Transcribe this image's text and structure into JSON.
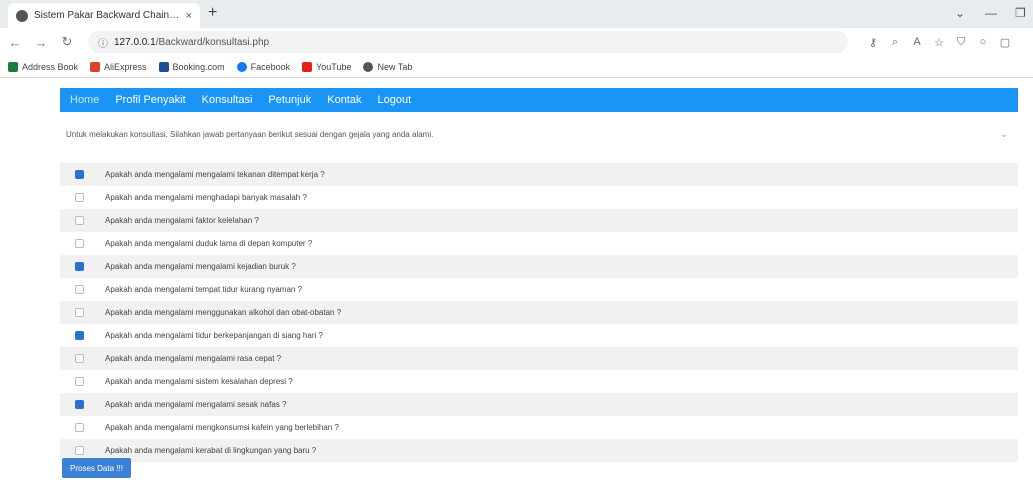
{
  "browser": {
    "tab_title": "Sistem Pakar Backward Chaining",
    "tab_close": "×",
    "new_tab": "+",
    "url_host": "127.0.0.1",
    "url_path": "/Backward/konsultasi.php",
    "bookmarks": [
      {
        "label": "Address Book",
        "color": "#1f7a3a"
      },
      {
        "label": "AliExpress",
        "color": "#d9432b"
      },
      {
        "label": "Booking.com",
        "color": "#1f4e96"
      },
      {
        "label": "Facebook",
        "color": "#1877f2"
      },
      {
        "label": "YouTube",
        "color": "#e62117"
      },
      {
        "label": "New Tab",
        "color": "#555555"
      }
    ]
  },
  "nav": {
    "items": [
      "Home",
      "Profil Penyakit",
      "Konsultasi",
      "Petunjuk",
      "Kontak",
      "Logout"
    ]
  },
  "intro": {
    "text": "Untuk melakukan konsultasi, Silahkan jawab pertanyaan berikut sesuai dengan gejala yang anda alami."
  },
  "questions": [
    {
      "text": "Apakah anda mengalami mengalami tekanan ditempat kerja ?",
      "checked": true
    },
    {
      "text": "Apakah anda mengalami menghadapi banyak masalah ?",
      "checked": false
    },
    {
      "text": "Apakah anda mengalami faktor kelelahan ?",
      "checked": false
    },
    {
      "text": "Apakah anda mengalami duduk lama di depan komputer ?",
      "checked": false
    },
    {
      "text": "Apakah anda mengalami mengalami kejadian buruk ?",
      "checked": true
    },
    {
      "text": "Apakah anda mengalami tempat tidur kurang nyaman ?",
      "checked": false
    },
    {
      "text": "Apakah anda mengalami menggunakan alkohol dan obat-obatan ?",
      "checked": false
    },
    {
      "text": "Apakah anda mengalami tidur berkepanjangan di siang hari ?",
      "checked": true
    },
    {
      "text": "Apakah anda mengalami mengalami rasa cepat ?",
      "checked": false
    },
    {
      "text": "Apakah anda mengalami sistem kesalahan depresi ?",
      "checked": false
    },
    {
      "text": "Apakah anda mengalami mengalami sesak nafas ?",
      "checked": true
    },
    {
      "text": "Apakah anda mengalami mengkonsumsi kafein yang berlebihan ?",
      "checked": false
    },
    {
      "text": "Apakah anda mengalami kerabat di lingkungan yang baru ?",
      "checked": false
    }
  ],
  "submit_label": "Proses Data !!!"
}
